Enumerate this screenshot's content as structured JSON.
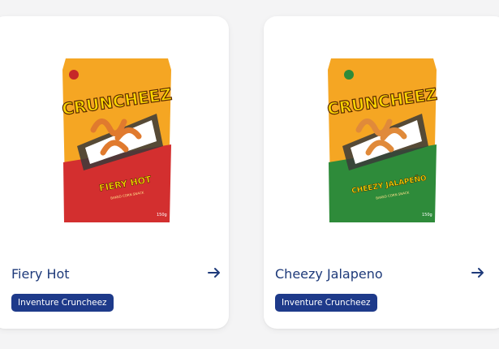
{
  "products": [
    {
      "name": "Fiery Hot",
      "brand_tag": "Inventure Cruncheez",
      "package": {
        "logo": "CRUNCHEEZ",
        "flavor": "FIERY HOT",
        "tagline": "BAKED CORN SNACK",
        "weight": "150g",
        "accent": "#d32f2f"
      },
      "icon": "arrow-right-icon"
    },
    {
      "name": "Cheezy Jalapeno",
      "brand_tag": "Inventure Cruncheez",
      "package": {
        "logo": "CRUNCHEEZ",
        "flavor": "CHEEZY JALAPEÑO",
        "tagline": "BAKED CORN SNACK",
        "weight": "150g",
        "accent": "#2e8b3a"
      },
      "icon": "arrow-right-icon"
    }
  ],
  "colors": {
    "title": "#1e3a7a",
    "badge_bg": "#1e3a8a",
    "card_bg": "#ffffff",
    "page_bg": "#f4f4f5"
  }
}
